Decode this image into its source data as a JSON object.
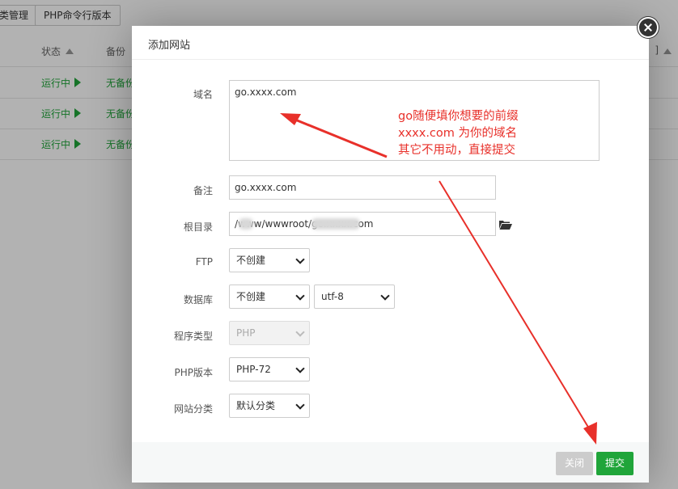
{
  "toolbar": {
    "left_btn_label": "类管理",
    "php_cli_label": "PHP命令行版本"
  },
  "table": {
    "headers": {
      "status": "状态",
      "backup": "备份",
      "right_corner": "]"
    },
    "rows": [
      {
        "status": "运行中",
        "backup": "无备份"
      },
      {
        "status": "运行中",
        "backup": "无备份"
      },
      {
        "status": "运行中",
        "backup": "无备份"
      }
    ]
  },
  "modal": {
    "title": "添加网站",
    "labels": {
      "domain": "域名",
      "remark": "备注",
      "root_dir": "根目录",
      "ftp": "FTP",
      "database": "数据库",
      "program_type": "程序类型",
      "php_version": "PHP版本",
      "site_category": "网站分类"
    },
    "values": {
      "domain": "go.xxxx.com",
      "remark": "go.xxxx.com",
      "root_dir": "/www/wwwroot/go.xxxx.com",
      "ftp": "不创建",
      "database": "不创建",
      "charset": "utf-8",
      "program_type": "PHP",
      "php_version": "PHP-72",
      "site_category": "默认分类"
    },
    "buttons": {
      "close": "关闭",
      "submit": "提交"
    }
  },
  "annotation": {
    "line1": "go随便填你想要的前缀",
    "line2": "xxxx.com 为你的域名",
    "line3": "其它不用动，直接提交"
  },
  "colors": {
    "accent_green": "#20a53a",
    "annotation_red": "#e8302a",
    "overlay": "rgba(0,0,0,0.3)"
  }
}
